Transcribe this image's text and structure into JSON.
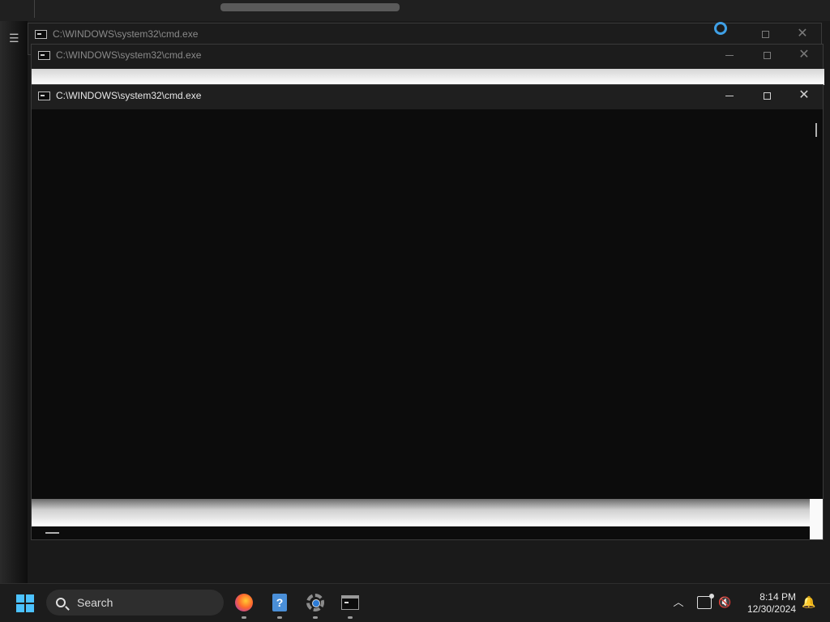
{
  "windows": [
    {
      "title": "C:\\WINDOWS\\system32\\cmd.exe",
      "state": "inactive"
    },
    {
      "title": "C:\\WINDOWS\\system32\\cmd.exe",
      "state": "inactive"
    },
    {
      "title": "C:\\WINDOWS\\system32\\cmd.exe",
      "state": "active"
    }
  ],
  "taskbar": {
    "search_label": "Search",
    "apps": [
      {
        "name": "Firefox",
        "icon": "firefox-icon"
      },
      {
        "name": "Help",
        "icon": "help-icon"
      },
      {
        "name": "Settings",
        "icon": "settings-gear-icon"
      },
      {
        "name": "Command Prompt",
        "icon": "terminal-icon"
      }
    ],
    "clock": {
      "time": "8:14 PM",
      "date": "12/30/2024"
    }
  },
  "colors": {
    "accent": "#4cc2ff",
    "console_bg": "#0c0c0c",
    "titlebar_bg": "#1c1c1c"
  }
}
